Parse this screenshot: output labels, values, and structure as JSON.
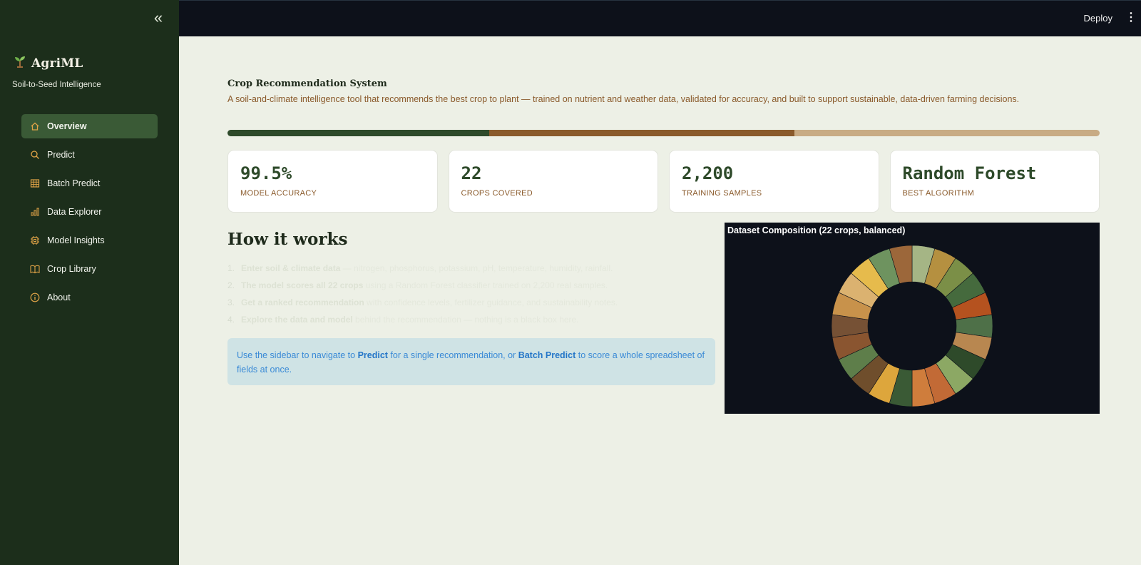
{
  "sidebar": {
    "collapse_icon": "double-chevron-left-icon",
    "brand": {
      "icon": "seedling-icon",
      "name": "AgriML",
      "tagline": "Soil-to-Seed Intelligence"
    },
    "items": [
      {
        "label": "Overview",
        "icon": "home-icon",
        "active": true
      },
      {
        "label": "Predict",
        "icon": "search-icon",
        "active": false
      },
      {
        "label": "Batch Predict",
        "icon": "table-icon",
        "active": false
      },
      {
        "label": "Data Explorer",
        "icon": "bar-chart-icon",
        "active": false
      },
      {
        "label": "Model Insights",
        "icon": "chip-icon",
        "active": false
      },
      {
        "label": "Crop Library",
        "icon": "book-icon",
        "active": false
      },
      {
        "label": "About",
        "icon": "info-icon",
        "active": false
      }
    ]
  },
  "topbar": {
    "deploy_label": "Deploy",
    "menu_icon": "kebab-menu-icon"
  },
  "header": {
    "title": "Crop Recommendation System",
    "description": "A soil-and-climate intelligence tool that recommends the best crop to plant — trained on nutrient and weather data, validated for accuracy, and built to support sustainable, data-driven farming decisions."
  },
  "tribar_colors": [
    "#2e4a2a",
    "#8a5a2b",
    "#c8ab84"
  ],
  "metrics": [
    {
      "value": "99.5%",
      "label": "MODEL ACCURACY"
    },
    {
      "value": "22",
      "label": "CROPS COVERED"
    },
    {
      "value": "2,200",
      "label": "TRAINING SAMPLES"
    },
    {
      "value": "Random Forest",
      "label": "BEST ALGORITHM"
    }
  ],
  "how": {
    "title": "How it works",
    "steps": [
      {
        "num": "1.",
        "bold": "Enter soil & climate data",
        "rest": " — nitrogen, phosphorus, potassium, pH, temperature, humidity, rainfall."
      },
      {
        "num": "2.",
        "bold": "The model scores all 22 crops",
        "rest": " using a Random Forest classifier trained on 2,200 real samples."
      },
      {
        "num": "3.",
        "bold": "Get a ranked recommendation",
        "rest": " with confidence levels, fertilizer guidance, and sustainability notes."
      },
      {
        "num": "4.",
        "bold": "Explore the data and model",
        "rest": " behind the recommendation — nothing is a black box here."
      }
    ],
    "info": {
      "t1": "Use the sidebar to navigate to ",
      "b1": "Predict",
      "t2": " for a single recommendation, or ",
      "b2": "Batch Predict",
      "t3": " to score a whole spreadsheet of fields at once."
    }
  },
  "chart_data": {
    "type": "pie",
    "title": "Dataset Composition (22 crops, balanced)",
    "donut": true,
    "values": [
      100,
      100,
      100,
      100,
      100,
      100,
      100,
      100,
      100,
      100,
      100,
      100,
      100,
      100,
      100,
      100,
      100,
      100,
      100,
      100,
      100,
      100
    ],
    "colors": [
      "#a5b585",
      "#b59040",
      "#7b8f47",
      "#456a3d",
      "#b5521f",
      "#4e7048",
      "#b88750",
      "#2e4a2a",
      "#8ca864",
      "#c26a36",
      "#cf7d3c",
      "#3a5a35",
      "#dda63c",
      "#6f4e2c",
      "#5e7e4a",
      "#8a5530",
      "#765135",
      "#c8924b",
      "#dbb270",
      "#e6bb4c",
      "#6e935f",
      "#9c673a"
    ]
  }
}
